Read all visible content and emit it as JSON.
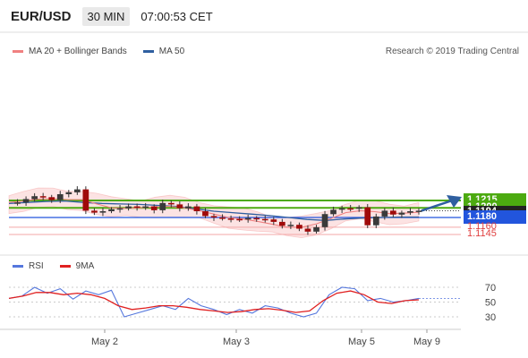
{
  "header": {
    "symbol": "EUR/USD",
    "timeframe": "30 MIN",
    "time": "07:00:53 CET"
  },
  "legend": {
    "ma20_label": "MA 20 + Bollinger Bands",
    "ma50_label": "MA 50",
    "rsi_label": "RSI",
    "ma9_label": "9MA",
    "source": "Research © 2019 Trading Central"
  },
  "colors": {
    "ma20": "#f08080",
    "ma50": "#2f5fa0",
    "band": "#fbd9d9",
    "resistance": "#4caa10",
    "support": "#2255dd",
    "minor": "#f3a7a7",
    "candle": "#a00a0a",
    "rsi": "#5577dd",
    "ma9": "#e02020",
    "current": "#222222"
  },
  "chart_data": {
    "type": "candlestick",
    "x_ticks": [
      "May 2",
      "May 3",
      "May 5",
      "May 9"
    ],
    "y_axis_labels": [
      "1.1215",
      "1.1200",
      "1.1194",
      "1.1180",
      "1.1160",
      "1.1145"
    ],
    "levels": [
      {
        "value": 1.1215,
        "label": "1.1215",
        "kind": "resistance"
      },
      {
        "value": 1.12,
        "label": "1.1200",
        "kind": "resistance"
      },
      {
        "value": 1.1194,
        "label": "1.1194",
        "kind": "current"
      },
      {
        "value": 1.118,
        "label": "1.1180",
        "kind": "support"
      },
      {
        "value": 1.116,
        "label": "1.1160",
        "kind": "minor"
      },
      {
        "value": 1.1145,
        "label": "1.1145",
        "kind": "minor"
      }
    ],
    "price_path": [
      1.1209,
      1.1211,
      1.1218,
      1.1224,
      1.1222,
      1.1216,
      1.1228,
      1.1232,
      1.1238,
      1.1194,
      1.119,
      1.1193,
      1.1197,
      1.1199,
      1.1203,
      1.1201,
      1.1203,
      1.1195,
      1.121,
      1.1207,
      1.1199,
      1.1203,
      1.1193,
      1.1183,
      1.118,
      1.1178,
      1.1177,
      1.1176,
      1.1179,
      1.1177,
      1.1176,
      1.1171,
      1.1163,
      1.1165,
      1.1157,
      1.1151,
      1.116,
      1.1187,
      1.1196,
      1.1199,
      1.1198,
      1.1201,
      1.1164,
      1.1182,
      1.1194,
      1.1186,
      1.119,
      1.1193,
      1.1194
    ],
    "projection": {
      "from": 1.1194,
      "to": 1.1215
    },
    "ma20": [
      1.1211,
      1.1214,
      1.1218,
      1.1219,
      1.1217,
      1.1217,
      1.1208,
      1.12,
      1.1199,
      1.12,
      1.1202,
      1.1203,
      1.12,
      1.1194,
      1.1187,
      1.118,
      1.1177,
      1.1172,
      1.1166,
      1.116,
      1.116,
      1.1167,
      1.1178,
      1.119,
      1.1194,
      1.1192,
      1.1188,
      1.1189,
      1.1191
    ],
    "ma50": [
      1.1209,
      1.1211,
      1.1213,
      1.1214,
      1.1211,
      1.1209,
      1.1208,
      1.1207,
      1.1205,
      1.1203,
      1.1198,
      1.1193,
      1.119,
      1.1187,
      1.1184,
      1.118,
      1.1176,
      1.1174,
      1.1177,
      1.1179,
      1.118,
      1.1181,
      1.1181
    ],
    "rsi": {
      "levels": [
        70,
        50,
        30
      ],
      "rsi_values": [
        55,
        58,
        70,
        62,
        68,
        54,
        65,
        60,
        66,
        30,
        35,
        40,
        45,
        40,
        55,
        45,
        40,
        33,
        40,
        35,
        45,
        42,
        35,
        30,
        35,
        60,
        70,
        68,
        52,
        55,
        50,
        52,
        55
      ],
      "ma9_values": [
        55,
        58,
        63,
        63,
        60,
        62,
        60,
        55,
        45,
        40,
        42,
        45,
        45,
        43,
        40,
        38,
        36,
        37,
        40,
        41,
        39,
        36,
        38,
        52,
        62,
        65,
        60,
        50,
        48,
        52,
        53
      ]
    }
  }
}
